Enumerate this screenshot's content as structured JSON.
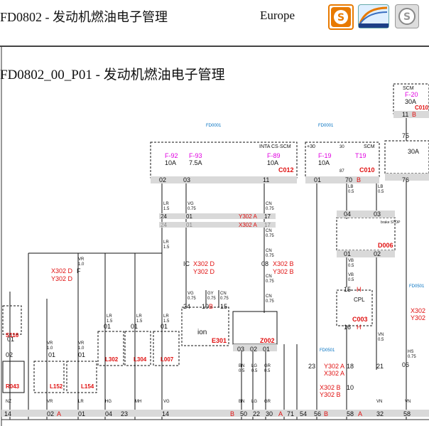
{
  "header": {
    "title": "FD0802 - 发动机燃油电子管理",
    "region": "Europe"
  },
  "page": {
    "subtitle": "FD0802_00_P01 - 发动机燃油电子管理"
  },
  "icons": [
    "s-logo-icon",
    "telemetry-logo-icon",
    "s-grey-logo-icon"
  ],
  "colors": {
    "red": "#e01010",
    "magenta": "#e000e0",
    "connector": "#d9d9d9",
    "wire": "#111111"
  },
  "fuse_boxes": {
    "left": {
      "ref": "FD0001",
      "tag": "INTA CS·SCM",
      "conn": "C012",
      "fuses": [
        {
          "id": "F-92",
          "amp": "10A"
        },
        {
          "id": "F-93",
          "amp": "7.5A"
        },
        {
          "id": "F-89",
          "amp": "10A"
        }
      ],
      "pins": [
        "02",
        "03",
        "11"
      ]
    },
    "right": {
      "ref": "FD0001",
      "tag": "+30",
      "scm": "SCM",
      "relay": "T19",
      "conn": "C010",
      "fuses": [
        {
          "id": "F-19",
          "amp": "10A"
        }
      ],
      "pins": [
        "01",
        "70",
        "B"
      ],
      "relay_pins": [
        "30",
        "87"
      ]
    },
    "corner": {
      "fuse": "F-20",
      "amp": "30A",
      "conn": "C010",
      "pins": [
        "11",
        "B",
        "75"
      ],
      "top": "SCM"
    },
    "relay_far": {
      "amp": "30A",
      "pin": "76"
    }
  },
  "wire_labels": {
    "lr15": [
      "LR",
      "1.5"
    ],
    "vg075": [
      "VG",
      "0.75"
    ],
    "cn075": [
      "CN",
      "0.75"
    ],
    "gy": [
      "GY",
      "0.75"
    ],
    "vr": [
      "VR",
      "1.0"
    ],
    "lb": [
      "LB",
      "0.5"
    ],
    "vb": [
      "VB",
      "0.5"
    ],
    "hs": [
      "HS",
      "0.75"
    ],
    "vn": [
      "VN",
      "0.5"
    ],
    "bn": [
      "BN",
      "0.5"
    ],
    "lg": [
      "LG",
      "0.5"
    ],
    "gr": [
      "GR",
      "0.5"
    ]
  },
  "connectors": {
    "x302a_row1": [
      "24",
      "01",
      "Y302 A",
      "17"
    ],
    "x302a_row2": [
      "24",
      "01",
      "X302 A",
      "17"
    ],
    "x302d": [
      "X302 D",
      "Y302 D"
    ],
    "x302d_f": "F",
    "x302b_right": [
      "X302 B",
      "Y302 B"
    ],
    "mid_ic": [
      "IC",
      "X302 D",
      "Y302 D"
    ],
    "mid_08": [
      "08",
      "X302 B",
      "Y302 B"
    ],
    "ion_box": "E301",
    "ion_label": "ion",
    "z002": "Z002",
    "z002_pins": [
      "03",
      "02",
      "01"
    ],
    "ion_pins": [
      "24",
      "10",
      "B",
      "15"
    ],
    "cpl": "CPL",
    "c003": "C003",
    "d006": "D006",
    "brake_label": "brake STOP",
    "fd0501": "FD0501",
    "rel_bottom_pins": [
      "01",
      "02",
      "04",
      "03"
    ],
    "pin15h": [
      "15",
      "H"
    ],
    "pin16h": [
      "16",
      "H"
    ],
    "left_blocks": [
      "S116",
      "R043",
      "L152",
      "L154",
      "L302",
      "L304",
      "L007"
    ],
    "mfp_pins": [
      "01",
      "02",
      "01",
      "01",
      "01",
      "01",
      "01"
    ],
    "bottom_pins": [
      "14",
      "02",
      "A",
      "01",
      "04",
      "23",
      "14",
      "B",
      "50",
      "22",
      "30",
      "A",
      "71",
      "54",
      "56",
      "B",
      "58",
      "A",
      "32",
      "58"
    ],
    "bottom_wires": [
      "NZ",
      "VR",
      "LR",
      "HG",
      "MH",
      "VG",
      "BN",
      "LG",
      "GR",
      "VN",
      "VN"
    ],
    "right_stack": [
      "23",
      "Y302 A",
      "X302 A",
      "18",
      "21",
      "X302 B",
      "Y302 B",
      "10"
    ],
    "right_far": [
      "X302",
      "Y302",
      "06"
    ],
    "far_ref": "FD0501"
  }
}
